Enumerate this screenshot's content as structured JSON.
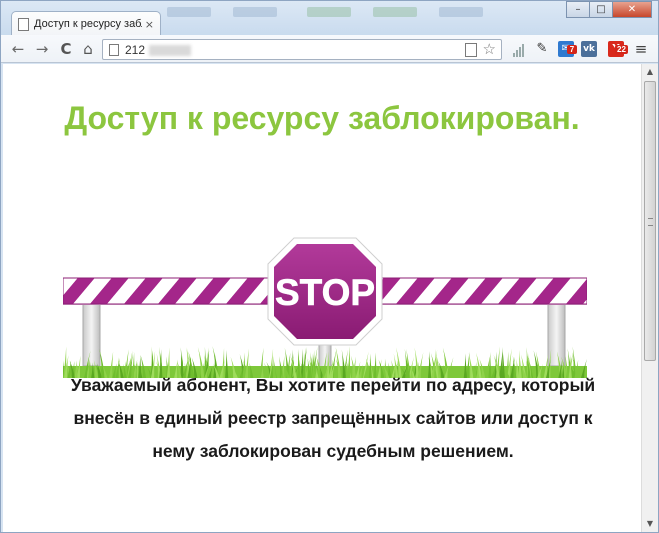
{
  "browser": {
    "tab_title": "Доступ к ресурсу заблок",
    "tab_close": "×",
    "url_visible": "212",
    "window_buttons": {
      "minimize": "–",
      "maximize": "□",
      "close": "✕"
    },
    "nav": {
      "back": "←",
      "forward": "→",
      "reload": "C",
      "home": "⌂"
    },
    "extensions": {
      "mail_badge": "7",
      "vk_label": "vk",
      "yandex_label": "Y",
      "yandex_badge": "22"
    },
    "menu": "≡"
  },
  "page": {
    "heading": "Доступ к ресурсу заблокирован.",
    "sign_text": "STOP",
    "notice": "Уважаемый абонент, Вы хотите перейти по адресу, который внесён в единый реестр запрещённых сайтов или доступ к нему заблокирован судебным решением."
  },
  "colors": {
    "heading": "#8cc63f",
    "sign": "#a4268a",
    "stripe": "#a4268a",
    "grass": "#7ec83a"
  }
}
